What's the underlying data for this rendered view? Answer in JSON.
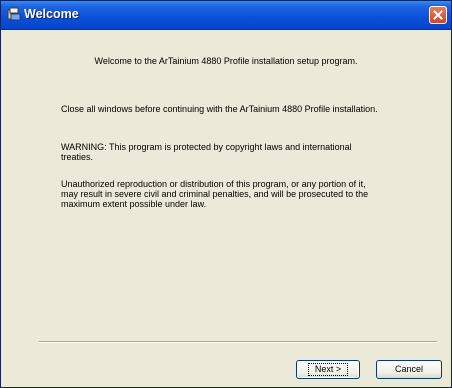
{
  "window": {
    "title": "Welcome",
    "icon": "installer-icon",
    "close_icon": "close-icon"
  },
  "content": {
    "welcome": "Welcome to the ArTainium 4880 Profile installation setup program.",
    "close_windows": "Close all windows before continuing with the ArTainium 4880 Profile installation.",
    "warning": "WARNING: This program is protected by copyright laws and international treaties.",
    "unauthorized": "Unauthorized reproduction or distribution of this program, or any portion of it, may result in severe civil and criminal penalties, and will be prosecuted to the maximum extent possible under law."
  },
  "buttons": {
    "next": "Next >",
    "cancel": "Cancel"
  }
}
